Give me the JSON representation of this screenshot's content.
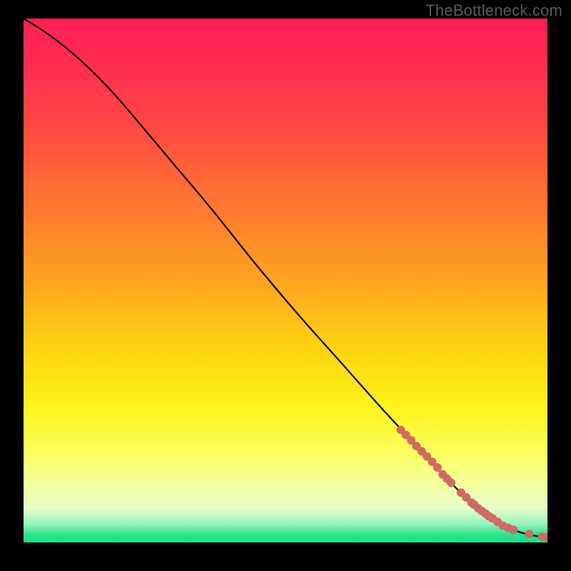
{
  "watermark": "TheBottleneck.com",
  "chart_data": {
    "type": "line",
    "title": "",
    "xlabel": "",
    "ylabel": "",
    "xlim": [
      0,
      100
    ],
    "ylim": [
      0,
      100
    ],
    "background_gradient_stops": [
      {
        "offset": 0.0,
        "color": "#ff1f55"
      },
      {
        "offset": 0.1,
        "color": "#ff2f50"
      },
      {
        "offset": 0.23,
        "color": "#ff5040"
      },
      {
        "offset": 0.36,
        "color": "#ff7830"
      },
      {
        "offset": 0.5,
        "color": "#ffa320"
      },
      {
        "offset": 0.62,
        "color": "#ffd012"
      },
      {
        "offset": 0.74,
        "color": "#fff31a"
      },
      {
        "offset": 0.83,
        "color": "#fbff60"
      },
      {
        "offset": 0.89,
        "color": "#f4ff9e"
      },
      {
        "offset": 0.935,
        "color": "#e5ffca"
      },
      {
        "offset": 0.965,
        "color": "#96f3bf"
      },
      {
        "offset": 0.985,
        "color": "#2be28c"
      },
      {
        "offset": 1.0,
        "color": "#1adf84"
      }
    ],
    "series": [
      {
        "name": "curve",
        "x": [
          0,
          4,
          8,
          12,
          16,
          20,
          28,
          36,
          44,
          52,
          60,
          68,
          74,
          80,
          84,
          88,
          90,
          92,
          94,
          96,
          98,
          100
        ],
        "y": [
          100,
          97.5,
          94.5,
          91.0,
          87.0,
          82.5,
          73.0,
          63.5,
          53.5,
          44.0,
          35.0,
          26.0,
          19.5,
          13.0,
          9.0,
          5.5,
          4.0,
          3.0,
          2.2,
          1.6,
          1.2,
          1.0
        ]
      }
    ],
    "markers": {
      "name": "points",
      "color": "#d16a63",
      "radius_px": 6,
      "x": [
        72,
        73,
        74,
        75,
        76,
        77,
        78,
        79,
        80,
        80.8,
        81.6,
        83.5,
        84.5,
        85.5,
        86.0,
        86.8,
        87.5,
        88.2,
        88.8,
        89.5,
        90.5,
        91.5,
        92.5,
        93.5,
        96.5,
        99.0,
        100.0
      ],
      "y": [
        21.5,
        20.5,
        19.5,
        18.4,
        17.4,
        16.4,
        15.4,
        14.3,
        13.0,
        12.2,
        11.4,
        9.5,
        8.6,
        7.6,
        7.2,
        6.5,
        6.0,
        5.5,
        5.0,
        4.6,
        3.9,
        3.2,
        2.8,
        2.4,
        1.6,
        1.1,
        1.0
      ]
    }
  }
}
